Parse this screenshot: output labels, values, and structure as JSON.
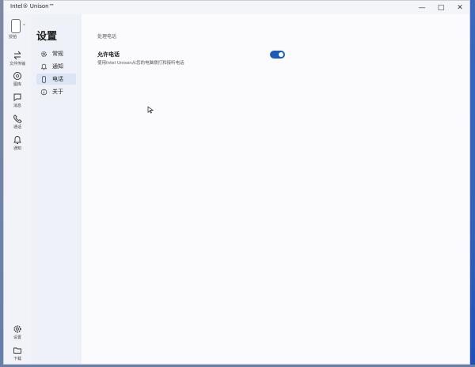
{
  "window": {
    "title": "Intel® Unison™"
  },
  "window_controls": {
    "minimize": "—",
    "maximize": "□",
    "close": "✕"
  },
  "rail": {
    "device_label": "授拍",
    "items": [
      {
        "name": "file-transfer",
        "icon": "swap-arrows-icon",
        "label": "文件传输"
      },
      {
        "name": "gallery",
        "icon": "gallery-icon",
        "label": "图库"
      },
      {
        "name": "messages",
        "icon": "message-icon",
        "label": "消息"
      },
      {
        "name": "calls",
        "icon": "phone-icon",
        "label": "通话"
      },
      {
        "name": "notifications",
        "icon": "bell-icon",
        "label": "通知"
      }
    ],
    "bottom_items": [
      {
        "name": "settings",
        "icon": "gear-icon",
        "label": "设置"
      },
      {
        "name": "downloads",
        "icon": "folder-icon",
        "label": "下载"
      }
    ]
  },
  "settings": {
    "title": "设置",
    "nav": [
      {
        "icon": "gear-icon",
        "label": "常规",
        "active": false
      },
      {
        "icon": "bell-icon",
        "label": "通知",
        "active": false
      },
      {
        "icon": "phone-outline-icon",
        "label": "电话",
        "active": true
      },
      {
        "icon": "info-icon",
        "label": "关于",
        "active": false
      }
    ]
  },
  "content": {
    "section_label": "处理电话",
    "setting_title": "允许电话",
    "setting_desc": "使用Intel Unison从您的电脑拨打和接听电话",
    "toggle_on": true
  },
  "colors": {
    "accent": "#1c5bb6",
    "active_nav_bg": "#dbe5f5"
  }
}
